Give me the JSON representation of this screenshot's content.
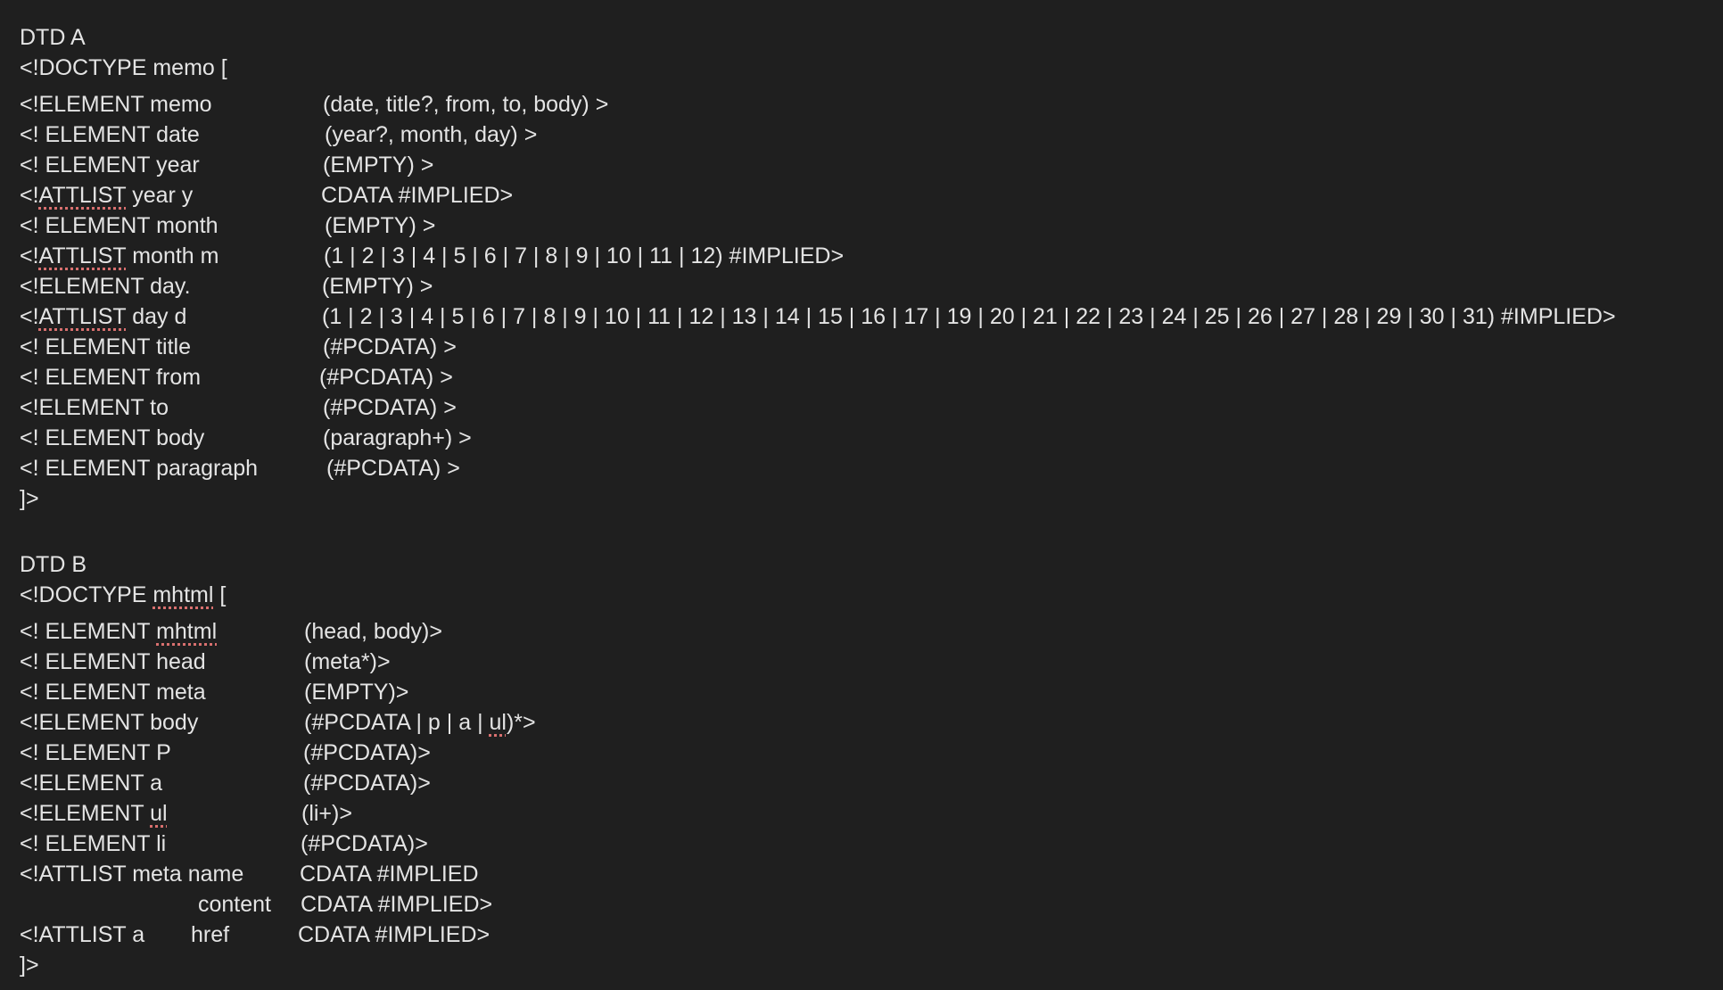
{
  "document": {
    "dtd_a": {
      "heading": "DTD A",
      "doctype_line": "<!DOCTYPE memo [",
      "rows": [
        {
          "decl": "<!ELEMENT memo",
          "model": "(date, title?, from, to, body) >"
        },
        {
          "decl": "<! ELEMENT date",
          "model": "(year?, month, day) >"
        },
        {
          "decl": "<! ELEMENT year",
          "model": "(EMPTY) >"
        },
        {
          "decl_prefix": "<!",
          "decl_flagged": "ATTLIST",
          "decl_suffix": " year y",
          "model": "CDATA #IMPLIED>"
        },
        {
          "decl": "<! ELEMENT month",
          "model": "(EMPTY) >"
        },
        {
          "decl_prefix": "<!",
          "decl_flagged": "ATTLIST",
          "decl_suffix": " month m",
          "model": "(1 | 2 | 3 | 4 | 5 | 6 | 7 | 8 | 9 | 10 | 11 | 12) #IMPLIED>"
        },
        {
          "decl": "<!ELEMENT day.",
          "model": "(EMPTY) >"
        },
        {
          "decl_prefix": "<!",
          "decl_flagged": "ATTLIST",
          "decl_suffix": " day d",
          "model": "(1 | 2 | 3 | 4 | 5 | 6 | 7 | 8 | 9 | 10 | 11 | 12 | 13 | 14 | 15 | 16 | 17 | 19 | 20 | 21 | 22 | 23 | 24 | 25 | 26 | 27 | 28 | 29 | 30 | 31) #IMPLIED>"
        },
        {
          "decl": "<! ELEMENT title",
          "model": "(#PCDATA) >"
        },
        {
          "decl": "<! ELEMENT from",
          "model": "(#PCDATA) >"
        },
        {
          "decl": "<!ELEMENT to",
          "model": "(#PCDATA) >"
        },
        {
          "decl": "<! ELEMENT body",
          "model": "(paragraph+) >"
        },
        {
          "decl": "<! ELEMENT paragraph",
          "model": "(#PCDATA) >"
        }
      ],
      "close": "]>"
    },
    "dtd_b": {
      "heading": "DTD B",
      "doctype_prefix": "<!DOCTYPE ",
      "doctype_flagged": "mhtml",
      "doctype_suffix": " [",
      "rows": [
        {
          "decl_prefix": "<! ELEMENT ",
          "decl_flagged": "mhtml",
          "decl_suffix": "",
          "model": "(head, body)>"
        },
        {
          "decl": "<! ELEMENT head",
          "model": "(meta*)>"
        },
        {
          "decl": "<! ELEMENT meta",
          "model": "(EMPTY)>"
        },
        {
          "decl": "<!ELEMENT body",
          "model_prefix": "(#PCDATA | p | a | ",
          "model_flagged": "ul",
          "model_suffix": ")*>"
        },
        {
          "decl": "<! ELEMENT P",
          "model": "(#PCDATA)>"
        },
        {
          "decl": "<!ELEMENT a",
          "model": "(#PCDATA)>"
        },
        {
          "decl_prefix": "<!ELEMENT ",
          "decl_flagged": "ul",
          "decl_suffix": "",
          "model": "(li+)>"
        },
        {
          "decl": "<! ELEMENT li",
          "model": "(#PCDATA)>"
        },
        {
          "decl": "<!ATTLIST meta name",
          "model": "CDATA #IMPLIED"
        },
        {
          "decl": "content",
          "model": "CDATA #IMPLIED>"
        },
        {
          "decl": "<!ATTLIST a",
          "attr": "href",
          "model": "CDATA #IMPLIED>"
        }
      ],
      "close": "]>"
    }
  }
}
